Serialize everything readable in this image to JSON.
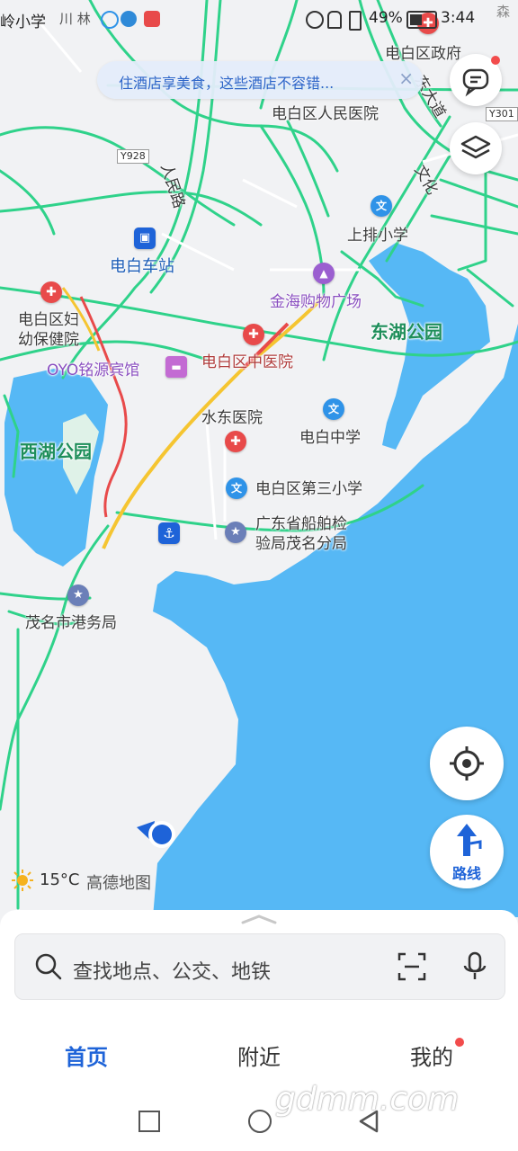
{
  "status_bar": {
    "carrier_text": "岭小学",
    "network": "川 林",
    "battery": "49%",
    "time": "3:44",
    "right_corner": "森"
  },
  "banner": {
    "text": "住酒店享美食，这些酒店不容错...",
    "close_label": "×"
  },
  "map": {
    "roads": {
      "renmin": "人民路",
      "y928": "Y928",
      "y301": "Y301",
      "dongda": "东大道",
      "xiandahe": "大",
      "wenhua": "文化"
    },
    "pois": {
      "gov": "电白区政府",
      "people_hospital": "电白区人民医院",
      "shangpai_school": "上排小学",
      "bus_station": "电白车站",
      "jinhai_mall": "金海购物广场",
      "donghu_park": "东湖公园",
      "maternal_hospital_1": "电白区妇",
      "maternal_hospital_2": "幼保健院",
      "tcm_hospital": "电白区中医院",
      "oyo_hotel": "OYO铭源宾馆",
      "shuidong_hospital": "水东医院",
      "middle_school": "电白中学",
      "xihu_park": "西湖公园",
      "third_primary": "电白区第三小学",
      "ship_bureau_1": "广东省船舶检",
      "ship_bureau_2": "验局茂名分局",
      "port_bureau": "茂名市港务局"
    },
    "weather_temp": "15°C",
    "provider": "高德地图",
    "route_label": "路线"
  },
  "search": {
    "placeholder": "查找地点、公交、地铁"
  },
  "tabs": [
    {
      "label": "首页",
      "active": true
    },
    {
      "label": "附近",
      "active": false
    },
    {
      "label": "我的",
      "active": false
    }
  ],
  "watermark": "gdmm.com",
  "colors": {
    "accent": "#1e63d8",
    "water": "#56b8f5",
    "road_green": "#2fd28a"
  }
}
